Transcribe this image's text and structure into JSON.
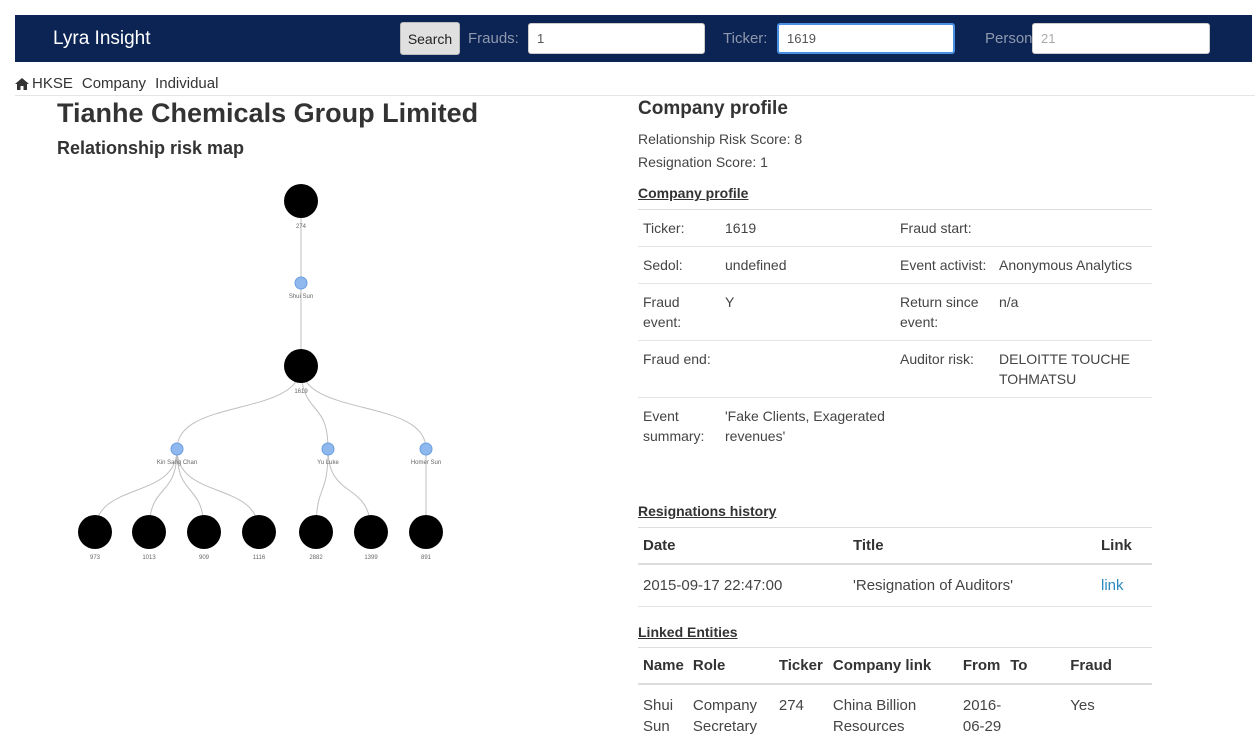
{
  "navbar": {
    "brand": "Lyra Insight",
    "search_label": "Search",
    "frauds_label": "Frauds:",
    "frauds_value": "1",
    "ticker_label": "Ticker:",
    "ticker_value": "1619",
    "person_label": "Person:",
    "person_value": "21",
    "bg_color": "#0b2454"
  },
  "breadcrumb": {
    "home_icon": "home-icon",
    "items": [
      "HKSE",
      "Company",
      "Individual"
    ]
  },
  "company": {
    "name": "Tianhe Chemicals Group Limited",
    "map_title": "Relationship risk map"
  },
  "risk_map": {
    "nodes": [
      {
        "id": "274",
        "label": "274",
        "type": "company"
      },
      {
        "id": "shui",
        "label": "Shui Sun",
        "type": "person"
      },
      {
        "id": "1619",
        "label": "1619",
        "type": "company"
      },
      {
        "id": "kin",
        "label": "Kin Sang Chan",
        "type": "person"
      },
      {
        "id": "yu",
        "label": "Yu Luke",
        "type": "person"
      },
      {
        "id": "homer",
        "label": "Homer Sun",
        "type": "person"
      },
      {
        "id": "973",
        "label": "973",
        "type": "company"
      },
      {
        "id": "1013",
        "label": "1013",
        "type": "company"
      },
      {
        "id": "909",
        "label": "909",
        "type": "company"
      },
      {
        "id": "1116",
        "label": "1116",
        "type": "company"
      },
      {
        "id": "2882",
        "label": "2882",
        "type": "company"
      },
      {
        "id": "1399",
        "label": "1399",
        "type": "company"
      },
      {
        "id": "891",
        "label": "891",
        "type": "company"
      }
    ],
    "edges": [
      [
        "274",
        "shui"
      ],
      [
        "shui",
        "1619"
      ],
      [
        "1619",
        "kin"
      ],
      [
        "1619",
        "yu"
      ],
      [
        "1619",
        "homer"
      ],
      [
        "kin",
        "973"
      ],
      [
        "kin",
        "1013"
      ],
      [
        "kin",
        "909"
      ],
      [
        "kin",
        "1116"
      ],
      [
        "yu",
        "2882"
      ],
      [
        "yu",
        "1399"
      ],
      [
        "homer",
        "891"
      ]
    ],
    "person_color": "#8fb8ee",
    "company_color": "#000000"
  },
  "profile": {
    "heading": "Company profile",
    "relationship_risk_score": "Relationship Risk Score: 8",
    "resignation_score": "Resignation Score: 1",
    "section_title": "Company profile",
    "rows": [
      {
        "l1": "Ticker:",
        "v1": "1619",
        "l2": "Fraud start:",
        "v2": ""
      },
      {
        "l1": "Sedol:",
        "v1": "undefined",
        "l2": "Event activist:",
        "v2": "Anonymous Analytics"
      },
      {
        "l1": "Fraud event:",
        "v1": "Y",
        "l2": "Return since event:",
        "v2": "n/a"
      },
      {
        "l1": "Fraud end:",
        "v1": "",
        "l2": "Auditor risk:",
        "v2": "DELOITTE TOUCHE TOHMATSU"
      },
      {
        "l1": "Event summary:",
        "v1": "'Fake Clients, Exagerated revenues'",
        "l2": "",
        "v2": ""
      }
    ]
  },
  "resignations": {
    "title": "Resignations history",
    "headers": [
      "Date",
      "Title",
      "Link"
    ],
    "rows": [
      {
        "date": "2015-09-17 22:47:00",
        "title": "'Resignation of Auditors'",
        "link": "link"
      }
    ]
  },
  "linked": {
    "title": "Linked Entities",
    "headers": [
      "Name",
      "Role",
      "Ticker",
      "Company link",
      "From",
      "To",
      "Fraud"
    ],
    "rows": [
      {
        "name": "Shui Sun",
        "role": "Company Secretary",
        "ticker": "274",
        "company_link": "China Billion Resources",
        "from": "2016-06-29",
        "to": "",
        "fraud": "Yes"
      }
    ]
  }
}
